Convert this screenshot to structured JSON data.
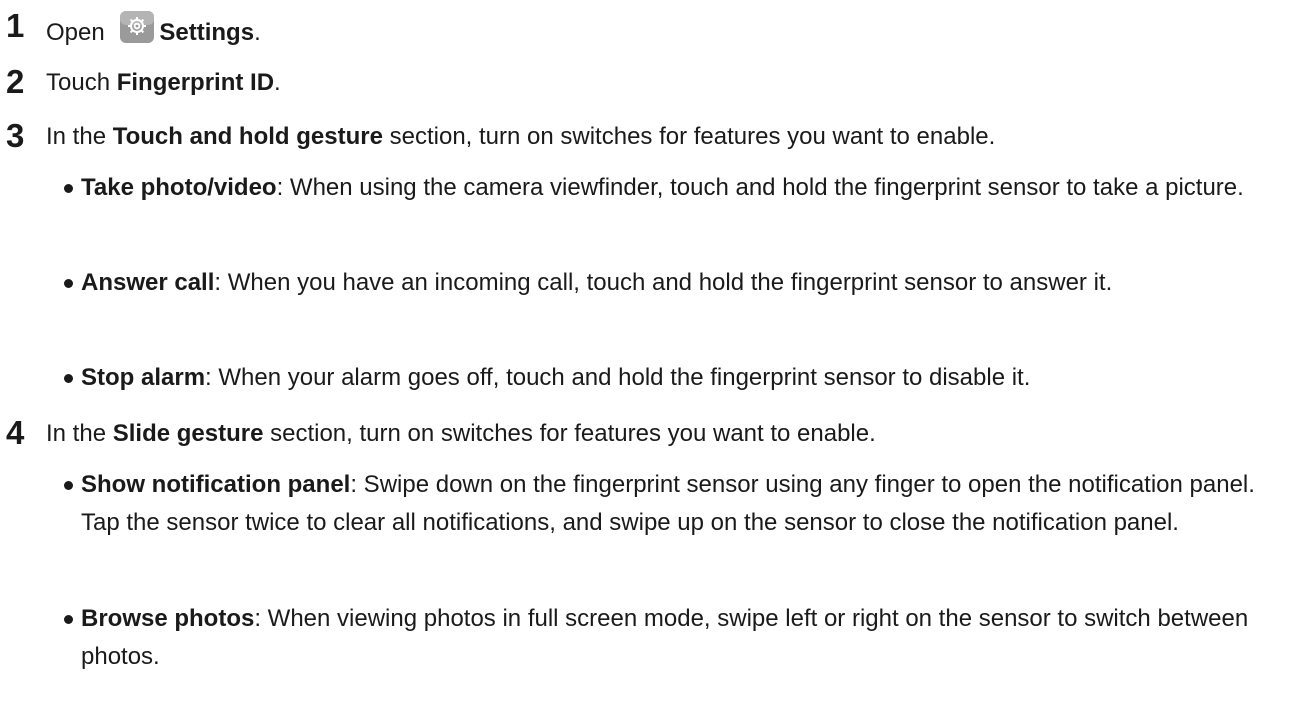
{
  "steps": [
    {
      "number": "1",
      "pre": "Open ",
      "icon": "settings-gear-icon",
      "bold": "Settings",
      "post": "."
    },
    {
      "number": "2",
      "pre": "Touch ",
      "bold": "Fingerprint ID",
      "post": "."
    },
    {
      "number": "3",
      "pre": "In the ",
      "bold": "Touch and hold gesture",
      "post": " section, turn on switches for features you want to enable.",
      "bullets": [
        {
          "bold": "Take photo/video",
          "text": ": When using the camera viewfinder, touch and hold the fingerprint sensor to take a picture."
        },
        {
          "bold": "Answer call",
          "text": ": When you have an incoming call, touch and hold the fingerprint sensor to answer it."
        },
        {
          "bold": "Stop alarm",
          "text": ": When your alarm goes off, touch and hold the fingerprint sensor to disable it."
        }
      ]
    },
    {
      "number": "4",
      "pre": "In the ",
      "bold": "Slide gesture",
      "post": " section, turn on switches for features you want to enable.",
      "bullets": [
        {
          "bold": "Show notification panel",
          "text": ": Swipe down on the fingerprint sensor using any finger to open the notification panel. Tap the sensor twice to clear all notifications, and swipe up on the sensor to close the notification panel."
        },
        {
          "bold": "Browse photos",
          "text": ": When viewing photos in full screen mode, swipe left or right on the sensor to switch between photos."
        }
      ]
    }
  ],
  "colors": {
    "text": "#1a1a1a",
    "icon_bg": "#9a9a9a",
    "icon_fg": "#ffffff"
  }
}
